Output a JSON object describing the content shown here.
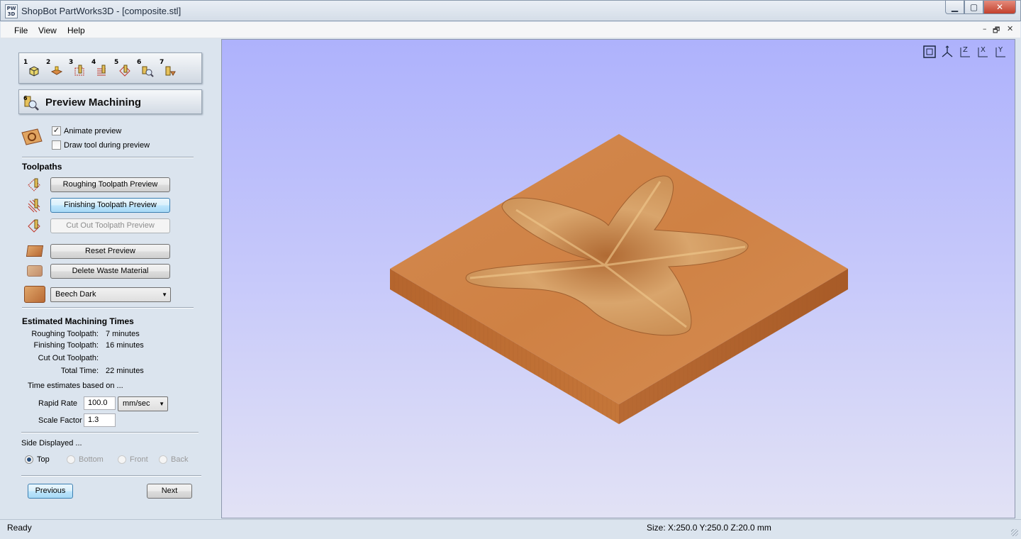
{
  "window": {
    "app_logo": "PW\n3D",
    "title": "ShopBot PartWorks3D - [composite.stl]",
    "controls": {
      "minimize": "▁",
      "maximize": "▢",
      "close": "✕"
    }
  },
  "menu": {
    "items": [
      "File",
      "View",
      "Help"
    ],
    "mdi": {
      "minimize": "–",
      "restore": "🗗",
      "close": "✕"
    }
  },
  "steps": [
    "1",
    "2",
    "3",
    "4",
    "5",
    "6",
    "7"
  ],
  "panel": {
    "title": "Preview Machining",
    "animate_preview": {
      "label": "Animate preview",
      "checked": true
    },
    "draw_tool": {
      "label": "Draw tool during preview",
      "checked": false
    },
    "toolpaths_heading": "Toolpaths",
    "buttons": {
      "roughing": "Roughing Toolpath Preview",
      "finishing": "Finishing Toolpath Preview",
      "cutout": "Cut Out Toolpath Preview",
      "reset": "Reset Preview",
      "delete_waste": "Delete Waste Material"
    },
    "material": "Beech Dark",
    "times_heading": "Estimated Machining Times",
    "times": [
      {
        "label": "Roughing Toolpath:",
        "value": "7 minutes"
      },
      {
        "label": "Finishing Toolpath:",
        "value": "16 minutes"
      },
      {
        "label": "Cut Out Toolpath:",
        "value": ""
      },
      {
        "label": "Total Time:",
        "value": "22 minutes"
      }
    ],
    "based_on": "Time estimates based on ...",
    "rapid_rate": {
      "label": "Rapid Rate",
      "value": "100.0",
      "unit": "mm/sec"
    },
    "scale_factor": {
      "label": "Scale Factor",
      "value": "1.3"
    },
    "side_heading": "Side Displayed ...",
    "sides": [
      {
        "label": "Top",
        "selected": true,
        "enabled": true
      },
      {
        "label": "Bottom",
        "selected": false,
        "enabled": false
      },
      {
        "label": "Front",
        "selected": false,
        "enabled": false
      },
      {
        "label": "Back",
        "selected": false,
        "enabled": false
      }
    ],
    "nav": {
      "previous": "Previous",
      "next": "Next"
    }
  },
  "viewport": {
    "view_icons": [
      "zoom-extents-icon",
      "iso-view-icon",
      "top-view-icon",
      "x-view-icon",
      "y-view-icon"
    ],
    "wood_colors": {
      "light": "#d98b4f",
      "mid": "#c77a3e",
      "dark": "#9c5a2b"
    },
    "background_top": "#aeb2fc",
    "background_bottom": "#e2e2f5"
  },
  "status": {
    "left": "Ready",
    "size": "Size: X:250.0 Y:250.0 Z:20.0 mm"
  }
}
